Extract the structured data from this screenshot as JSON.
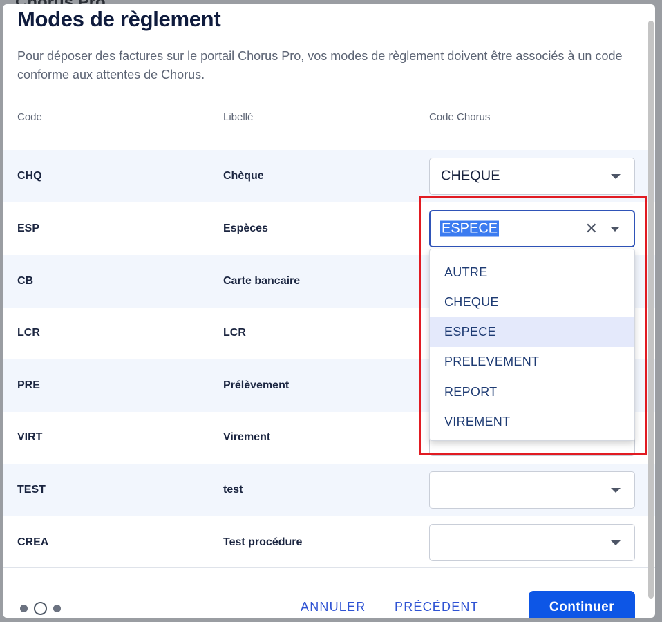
{
  "background": {
    "title": "Chorus Pro"
  },
  "modal": {
    "title": "Modes de règlement",
    "description": "Pour déposer des factures sur le portail Chorus Pro, vos modes de règlement doivent être associés à un code conforme aux attentes de Chorus."
  },
  "columns": {
    "code": "Code",
    "label": "Libellé",
    "chorus": "Code Chorus"
  },
  "rows": [
    {
      "code": "CHQ",
      "label": "Chèque",
      "chorus": "CHEQUE"
    },
    {
      "code": "ESP",
      "label": "Espèces",
      "chorus": "ESPECE"
    },
    {
      "code": "CB",
      "label": "Carte bancaire",
      "chorus": ""
    },
    {
      "code": "LCR",
      "label": "LCR",
      "chorus": ""
    },
    {
      "code": "PRE",
      "label": "Prélèvement",
      "chorus": ""
    },
    {
      "code": "VIRT",
      "label": "Virement",
      "chorus": ""
    },
    {
      "code": "TEST",
      "label": "test",
      "chorus": ""
    },
    {
      "code": "CREA",
      "label": "Test procédure",
      "chorus": ""
    }
  ],
  "dropdown": {
    "options": [
      "AUTRE",
      "CHEQUE",
      "ESPECE",
      "PRELEVEMENT",
      "REPORT",
      "VIREMENT"
    ],
    "selected": "ESPECE"
  },
  "footer": {
    "cancel": "ANNULER",
    "previous": "PRÉCÉDENT",
    "continue": "Continuer"
  },
  "colors": {
    "primary": "#0d56e6",
    "highlight": "#e11b22",
    "selected_option": "#e4e9fb"
  }
}
